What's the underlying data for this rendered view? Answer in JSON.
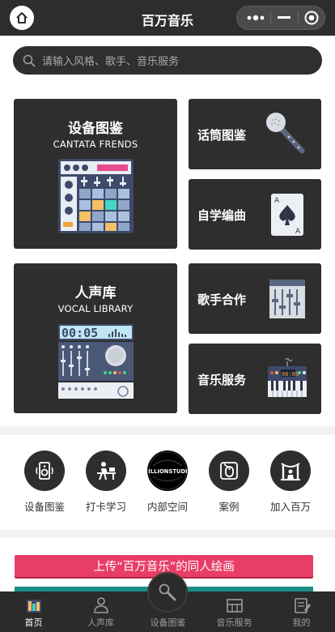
{
  "header": {
    "title": "百万音乐"
  },
  "search": {
    "placeholder": "请输入风格、歌手、音乐服务"
  },
  "cards": {
    "equipment": {
      "title_cn": "设备图鉴",
      "title_en": "CANTATA FRENDS",
      "icon": "drum-machine-icon"
    },
    "vocal": {
      "title_cn": "人声库",
      "title_en": "VOCAL LIBRARY",
      "icon": "mixer-console-icon"
    },
    "mic": {
      "label": "话筒图鉴",
      "icon": "microphone-icon"
    },
    "self_study": {
      "label": "自学编曲",
      "icon": "playing-card-icon"
    },
    "singer": {
      "label": "歌手合作",
      "icon": "equalizer-icon"
    },
    "service": {
      "label": "音乐服务",
      "icon": "synthesizer-icon"
    }
  },
  "circles": [
    {
      "label": "设备图鉴",
      "icon": "speaker-icon"
    },
    {
      "label": "打卡学习",
      "icon": "desk-study-icon"
    },
    {
      "label": "内部空间",
      "icon": "millionstudio-logo",
      "logo_text": "MILLIONSTUDIO"
    },
    {
      "label": "案例",
      "icon": "mouse-icon"
    },
    {
      "label": "加入百万",
      "icon": "stage-icon"
    }
  ],
  "banner": {
    "text": "上传“百万音乐”的同人绘画"
  },
  "tabs": [
    {
      "label": "首页",
      "icon": "home-equalizer-icon",
      "active": true
    },
    {
      "label": "人声库",
      "icon": "singer-icon"
    },
    {
      "label": "设备图鉴",
      "icon": "mic-center-icon"
    },
    {
      "label": "音乐服务",
      "icon": "piano-icon"
    },
    {
      "label": "我的",
      "icon": "profile-icon"
    }
  ],
  "colors": {
    "dark": "#2e2e2e",
    "banner": "#e83d67",
    "accent_teal": "#1a8f86"
  }
}
